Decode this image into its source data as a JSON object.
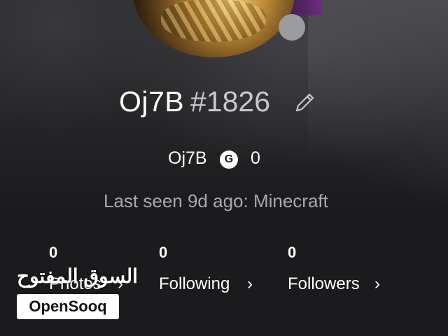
{
  "profile": {
    "gamertag": "Oj7B",
    "gamertag_suffix": "#1826",
    "real_name": "Oj7B",
    "gamerscore_badge": "G",
    "gamerscore": "0",
    "last_seen": "Last seen 9d ago: Minecraft",
    "status_color": "#9c9c9e"
  },
  "stats": [
    {
      "count": "0",
      "label": "Photos"
    },
    {
      "count": "0",
      "label": "Following"
    },
    {
      "count": "0",
      "label": "Followers"
    }
  ],
  "watermark": {
    "arabic": "السوق المفتوح",
    "brand": "OpenSooq"
  },
  "icons": {
    "edit": "pencil-icon",
    "chevron": "chevron-right-icon"
  }
}
